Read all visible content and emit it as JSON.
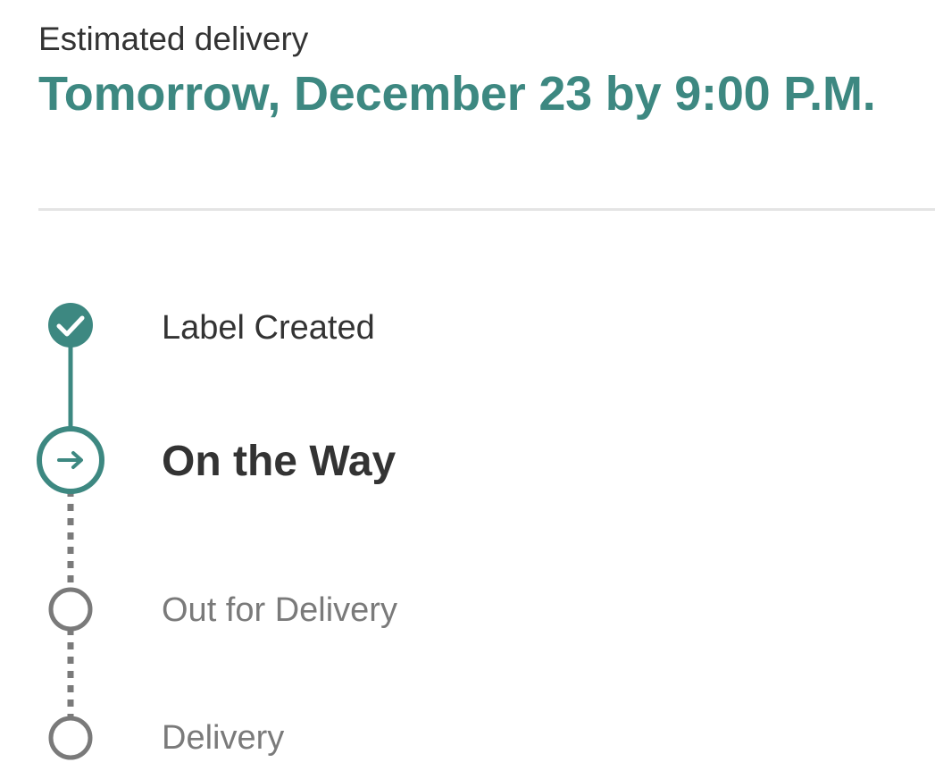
{
  "delivery": {
    "estimate_label": "Estimated delivery",
    "estimate_value": "Tomorrow, December 23 by 9:00 P.M."
  },
  "tracking": {
    "steps": [
      {
        "label": "Label Created",
        "status": "completed",
        "icon": "check-icon"
      },
      {
        "label": "On the Way",
        "status": "current",
        "icon": "arrow-right-icon"
      },
      {
        "label": "Out for Delivery",
        "status": "pending",
        "icon": "empty-circle-icon"
      },
      {
        "label": "Delivery",
        "status": "pending",
        "icon": "empty-circle-icon"
      }
    ]
  },
  "colors": {
    "accent": "#3d8881",
    "text_primary": "#333333",
    "text_muted": "#7a7a7a",
    "connector_pending": "#7a7a7a",
    "divider": "#e4e4e4"
  }
}
